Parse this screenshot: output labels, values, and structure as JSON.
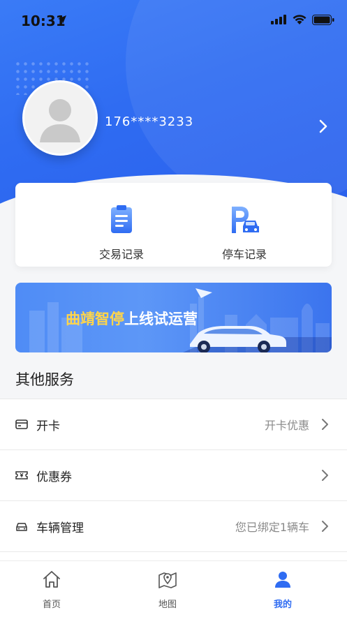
{
  "status_bar": {
    "time": "10:31"
  },
  "profile": {
    "phone": "176****3233"
  },
  "records": [
    {
      "label": "交易记录",
      "icon": "clipboard-icon"
    },
    {
      "label": "停车记录",
      "icon": "parking-car-icon"
    }
  ],
  "banner": {
    "highlight": "曲靖智停",
    "rest": "上线试运营"
  },
  "section": {
    "title": "其他服务"
  },
  "services": [
    {
      "label": "开卡",
      "value": "开卡优惠",
      "icon": "card-icon"
    },
    {
      "label": "优惠券",
      "value": "",
      "icon": "coupon-icon"
    },
    {
      "label": "车辆管理",
      "value": "您已绑定1辆车",
      "icon": "car-icon"
    }
  ],
  "tabs": [
    {
      "label": "首页",
      "icon": "home-icon"
    },
    {
      "label": "地图",
      "icon": "map-pin-icon"
    },
    {
      "label": "我的",
      "icon": "user-icon",
      "active": true
    }
  ],
  "colors": {
    "primary": "#2f6cf2",
    "banner_highlight": "#ffd54a"
  }
}
